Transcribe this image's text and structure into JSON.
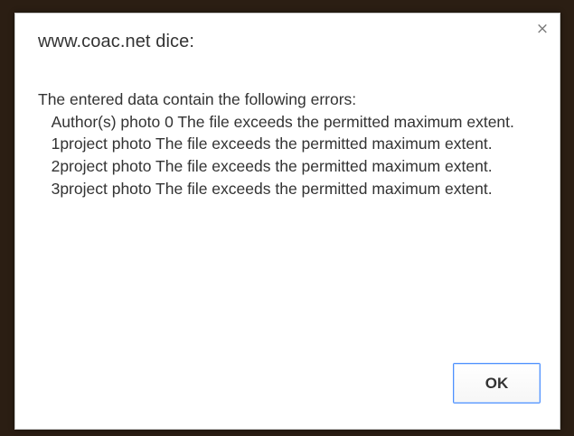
{
  "dialog": {
    "title": "www.coac.net dice:",
    "close_glyph": "×",
    "close_icon": "close-icon",
    "message_lines": [
      "The entered data contain the following errors:",
      "   Author(s) photo 0 The file exceeds the permitted maximum extent.",
      "   1project photo The file exceeds the permitted maximum extent.",
      "   2project photo The file exceeds the permitted maximum extent.",
      "   3project photo The file exceeds the permitted maximum extent."
    ],
    "ok_label": "OK"
  },
  "colors": {
    "backdrop": "#2b1e13",
    "dialog_bg": "#ffffff",
    "text": "#333333",
    "button_focus": "#4d90fe"
  }
}
